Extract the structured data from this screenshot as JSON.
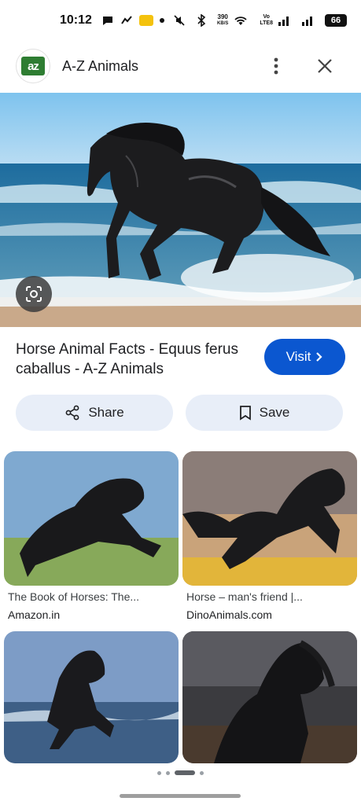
{
  "status_bar": {
    "time": "10:12",
    "net_speed_value": "390",
    "net_speed_unit": "KB/S",
    "volte_top": "Vo",
    "volte_bottom": "LTE8",
    "battery": "66",
    "icons": [
      "chat-icon",
      "call-forward-icon",
      "yellow-app-icon",
      "dot-icon",
      "mute-icon",
      "bluetooth-icon",
      "wifi-icon",
      "signal-icon",
      "signal-icon-2"
    ]
  },
  "header": {
    "logo_text": "az",
    "site_name": "A-Z Animals",
    "more_icon": "more-vert-icon",
    "close_icon": "close-icon"
  },
  "result": {
    "title": "Horse Animal Facts - Equus ferus caballus - A-Z Animals",
    "visit_label": "Visit",
    "share_label": "Share",
    "save_label": "Save"
  },
  "related": [
    {
      "caption": "The Book of Horses: The...",
      "source": "Amazon.in"
    },
    {
      "caption": "Horse – man's friend |...",
      "source": "DinoAnimals.com"
    },
    {
      "caption": "",
      "source": ""
    },
    {
      "caption": "",
      "source": ""
    }
  ],
  "colors": {
    "accent": "#0b57d0",
    "pill_bg": "#e8eef8",
    "logo_green": "#2e7d32"
  }
}
